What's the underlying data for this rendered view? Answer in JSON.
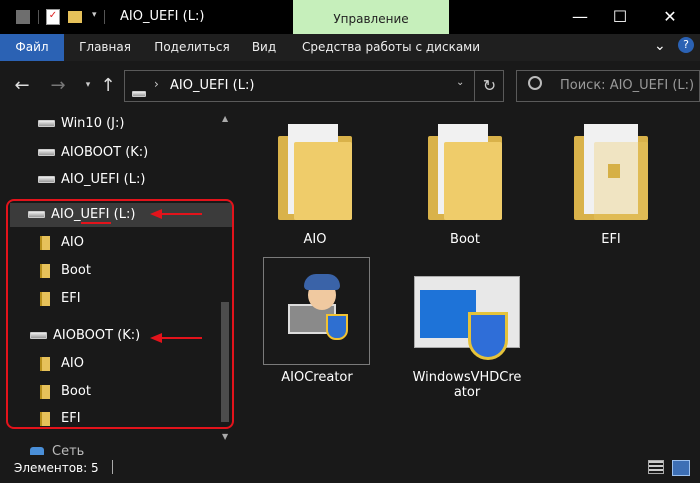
{
  "window": {
    "title": "AIO_UEFI (L:)",
    "manage_tab": "Управление",
    "controls": {
      "minimize": "—",
      "maximize": "☐",
      "close": "✕"
    }
  },
  "ribbon": {
    "tabs": [
      "Файл",
      "Главная",
      "Поделиться",
      "Вид",
      "Средства работы с дисками"
    ]
  },
  "navigation": {
    "back": "←",
    "forward": "→",
    "up": "↑",
    "address": "AIO_UEFI (L:)",
    "refresh": "↻",
    "search_placeholder": "Поиск: AIO_UEFI (L:)"
  },
  "nav_pane": {
    "items": [
      {
        "label": "Win10 (J:)",
        "type": "drive"
      },
      {
        "label": "AIOBOOT (K:)",
        "type": "drive"
      },
      {
        "label": "AIO_UEFI (L:)",
        "type": "drive"
      },
      {
        "label": "AIO_UEFI (L:)",
        "type": "drive"
      },
      {
        "label": "AIO",
        "type": "folder"
      },
      {
        "label": "Boot",
        "type": "folder"
      },
      {
        "label": "EFI",
        "type": "folder"
      },
      {
        "label": "AIOBOOT (K:)",
        "type": "drive"
      },
      {
        "label": "AIO",
        "type": "folder"
      },
      {
        "label": "Boot",
        "type": "folder"
      },
      {
        "label": "EFI",
        "type": "folder"
      },
      {
        "label": "Сеть",
        "type": "network"
      }
    ]
  },
  "content": {
    "items": [
      {
        "label": "AIO"
      },
      {
        "label": "Boot"
      },
      {
        "label": "EFI"
      },
      {
        "label": "AIOCreator"
      },
      {
        "label": "WindowsVHDCreator",
        "line1": "WindowsVHDCre",
        "line2": "ator"
      }
    ]
  },
  "status": {
    "items_count": "Элементов: 5"
  },
  "colors": {
    "accent": "#2b62b4",
    "manage_tab": "#c6efbb",
    "annotation": "#e3131b",
    "folder": "#e6c15a"
  }
}
